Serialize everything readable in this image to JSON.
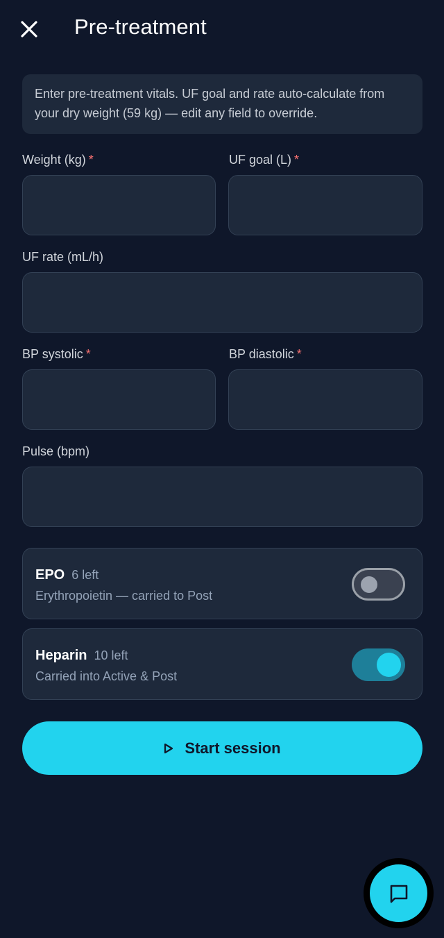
{
  "header": {
    "title": "Pre-treatment",
    "close_icon": "close-icon"
  },
  "info": {
    "text": "Enter pre-treatment vitals. UF goal and rate auto-calculate from your dry weight (59 kg) — edit any field to override."
  },
  "fields": {
    "weight": {
      "label": "Weight (kg)",
      "required_mark": "*",
      "value": ""
    },
    "uf_goal": {
      "label": "UF goal (L)",
      "required_mark": "*",
      "value": ""
    },
    "uf_rate": {
      "label": "UF rate (mL/h)",
      "value": ""
    },
    "bp_systolic": {
      "label": "BP systolic",
      "required_mark": "*",
      "value": ""
    },
    "bp_diastolic": {
      "label": "BP diastolic",
      "required_mark": "*",
      "value": ""
    },
    "pulse": {
      "label": "Pulse (bpm)",
      "value": ""
    }
  },
  "meds": [
    {
      "name": "EPO",
      "count": "6 left",
      "description": "Erythropoietin — carried to Post",
      "enabled": false
    },
    {
      "name": "Heparin",
      "count": "10 left",
      "description": "Carried into Active & Post",
      "enabled": true
    }
  ],
  "actions": {
    "start_label": "Start session",
    "start_icon": "play-icon",
    "fab_icon": "chat-icon"
  },
  "colors": {
    "background": "#0f172a",
    "surface": "#1e293b",
    "accent": "#22d3ee",
    "required": "#f87171"
  }
}
